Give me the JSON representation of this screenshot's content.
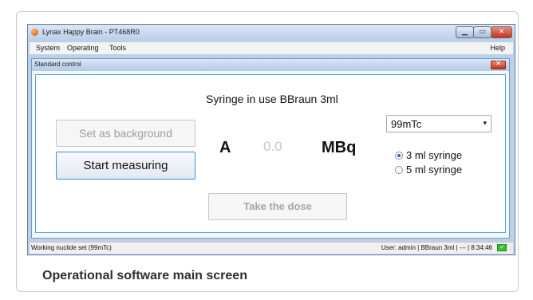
{
  "window": {
    "title": "Lynax Happy Brain - PT468R0",
    "controls": {
      "minimize": "▁",
      "maximize": "▭",
      "close": "✕"
    }
  },
  "menubar": {
    "items": [
      "System",
      "Operating",
      "Tools"
    ],
    "help": "Help"
  },
  "dialog": {
    "title": "Standard control",
    "close": "✕"
  },
  "panel": {
    "syringe_label": "Syringe in use BBraun 3ml",
    "set_background_label": "Set as background",
    "start_measuring_label": "Start measuring",
    "take_dose_label": "Take the dose",
    "activity": {
      "unit_symbol": "A",
      "value": "0.0",
      "unit": "MBq"
    },
    "nuclide_select": {
      "value": "99mTc",
      "arrow": "▾"
    },
    "syringe_options": [
      {
        "label": "3 ml syringe",
        "selected": true
      },
      {
        "label": "5 ml syringe",
        "selected": false
      }
    ]
  },
  "statusbar": {
    "left": "Working nuclide set (99mTc)",
    "right": "User: admin  |  BBraun 3ml  |  ---  |  8:34:46",
    "ok_icon": "✓",
    "grip": ".:"
  },
  "caption": "Operational software main screen",
  "colors": {
    "accent_border": "#4aa8e0",
    "ok": "#36c02a",
    "close": "#c2331d"
  }
}
